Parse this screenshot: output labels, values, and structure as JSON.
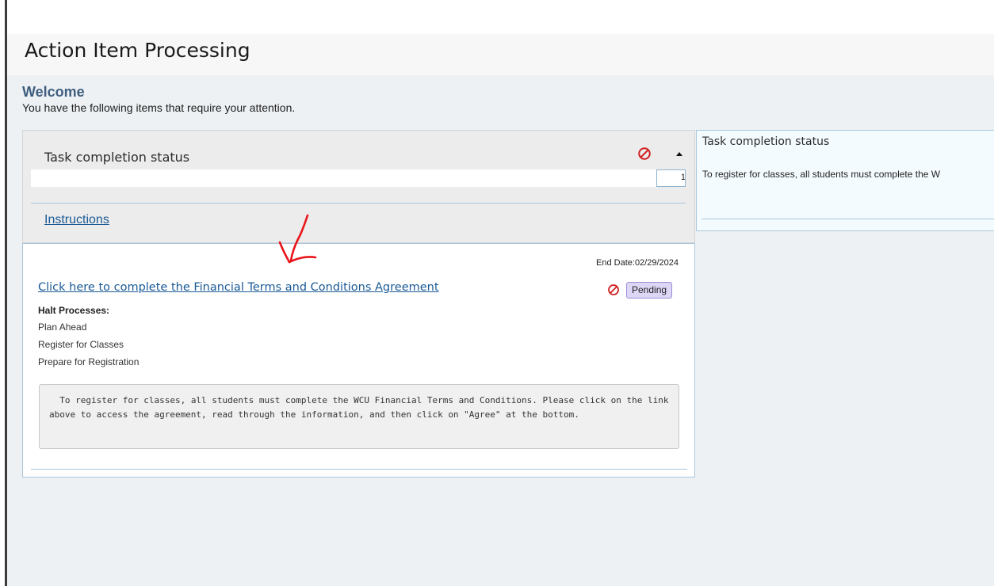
{
  "page": {
    "title": "Action Item Processing"
  },
  "welcome": {
    "heading": "Welcome",
    "subtitle": "You have the following items that require your attention."
  },
  "status_panel": {
    "title": "Task completion status",
    "status_icon": "blocked-icon",
    "caret_icon": "caret-up-icon",
    "progress_count": "1",
    "instructions_link": "Instructions"
  },
  "action_item": {
    "end_date_label": "End Date:",
    "end_date": "02/29/2024",
    "link_text": "Click here to complete the Financial Terms and Conditions Agreement",
    "status_label": "Pending",
    "halt_heading": "Halt Processes:",
    "halt_processes": [
      "Plan Ahead",
      "Register for Classes",
      "Prepare for Registration"
    ],
    "instruction_text": "  To register for classes, all students must complete the WCU Financial Terms and Conditions. Please click on the link above to access the agreement, read through the information, and then click on \"Agree\" at the bottom."
  },
  "side_panel": {
    "title": "Task completion status",
    "text": "To register for classes, all students must complete the W"
  },
  "colors": {
    "link": "#1a5a96",
    "heading": "#3f5e7e",
    "blocked": "#d11f1f",
    "pending_bg": "#ddd6f5",
    "annotation": "#e8161b"
  }
}
